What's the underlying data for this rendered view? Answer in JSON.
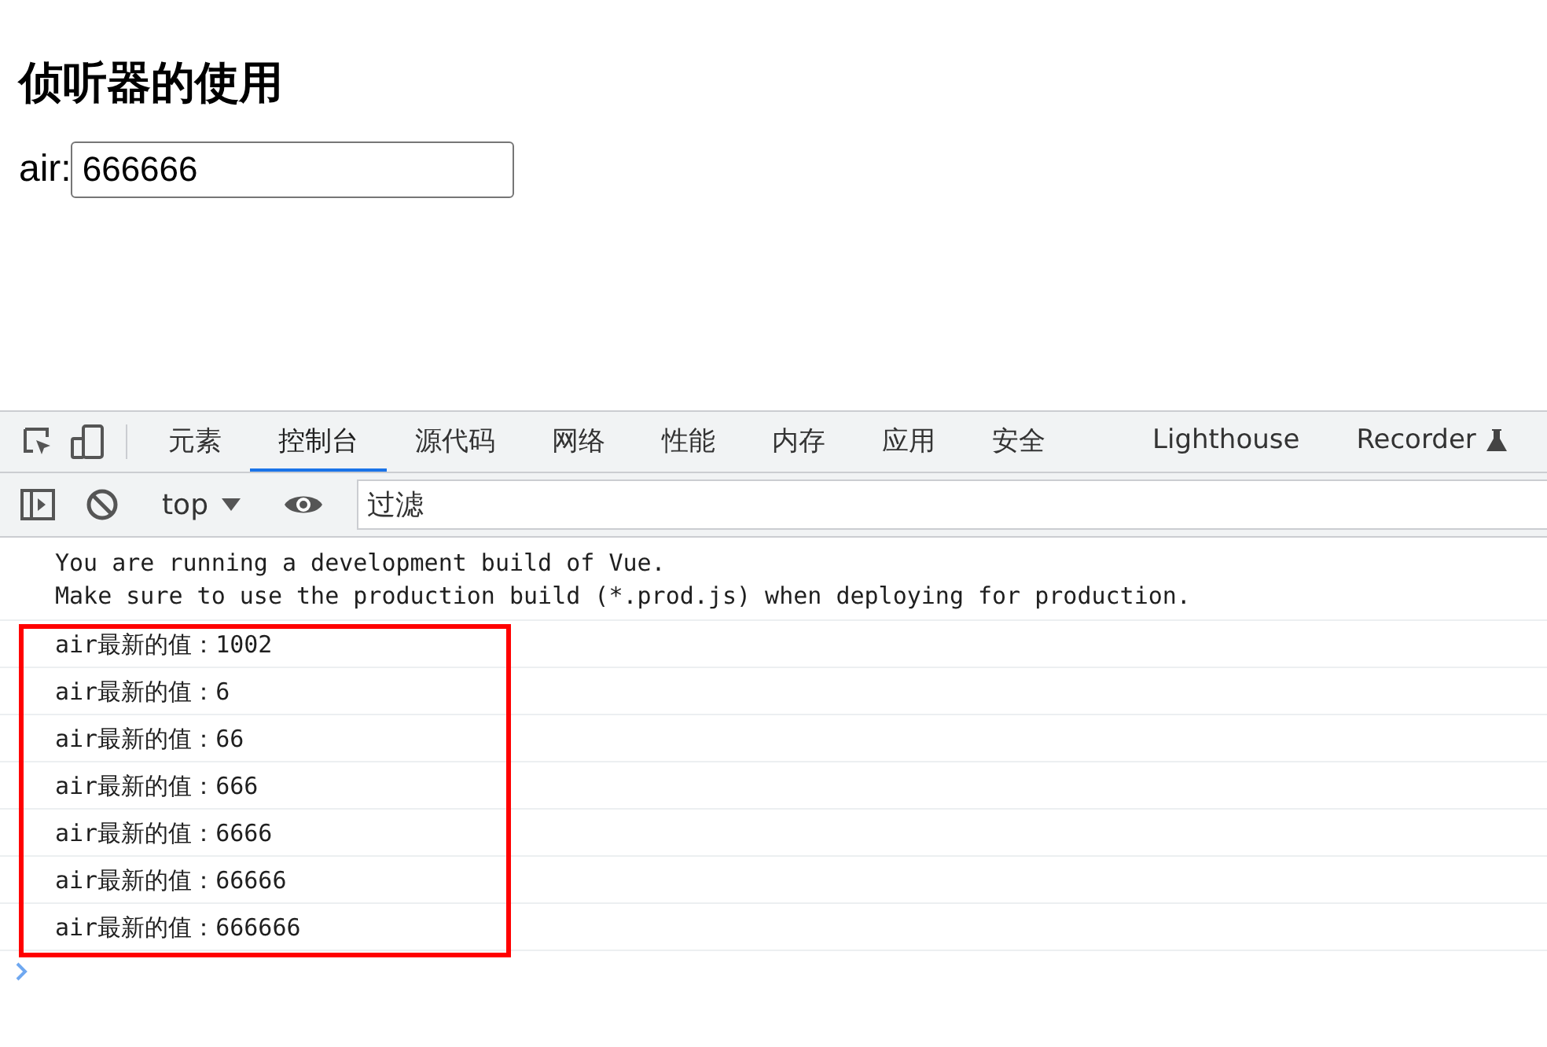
{
  "page": {
    "heading": "侦听器的使用",
    "field": {
      "label": "air:",
      "value": "666666"
    }
  },
  "devtools": {
    "tabs": [
      {
        "label": "元素",
        "selected": false
      },
      {
        "label": "控制台",
        "selected": true
      },
      {
        "label": "源代码",
        "selected": false
      },
      {
        "label": "网络",
        "selected": false
      },
      {
        "label": "性能",
        "selected": false
      },
      {
        "label": "内存",
        "selected": false
      },
      {
        "label": "应用",
        "selected": false
      },
      {
        "label": "安全",
        "selected": false
      },
      {
        "label": "Lighthouse",
        "selected": false
      },
      {
        "label": "Recorder",
        "selected": false
      }
    ],
    "toolbar": {
      "context": "top",
      "filter": {
        "placeholder": "过滤"
      }
    },
    "messages": [
      {
        "kind": "info",
        "lines": [
          "You are running a development build of Vue.",
          "Make sure to use the production build (*.prod.js) when deploying for production."
        ]
      },
      {
        "kind": "framed_group",
        "entries": [
          "air最新的值：1002",
          "air最新的值：6",
          "air最新的值：66",
          "air最新的值：666",
          "air最新的值：6666",
          "air最新的值：66666",
          "air最新的值：666666"
        ]
      }
    ]
  }
}
